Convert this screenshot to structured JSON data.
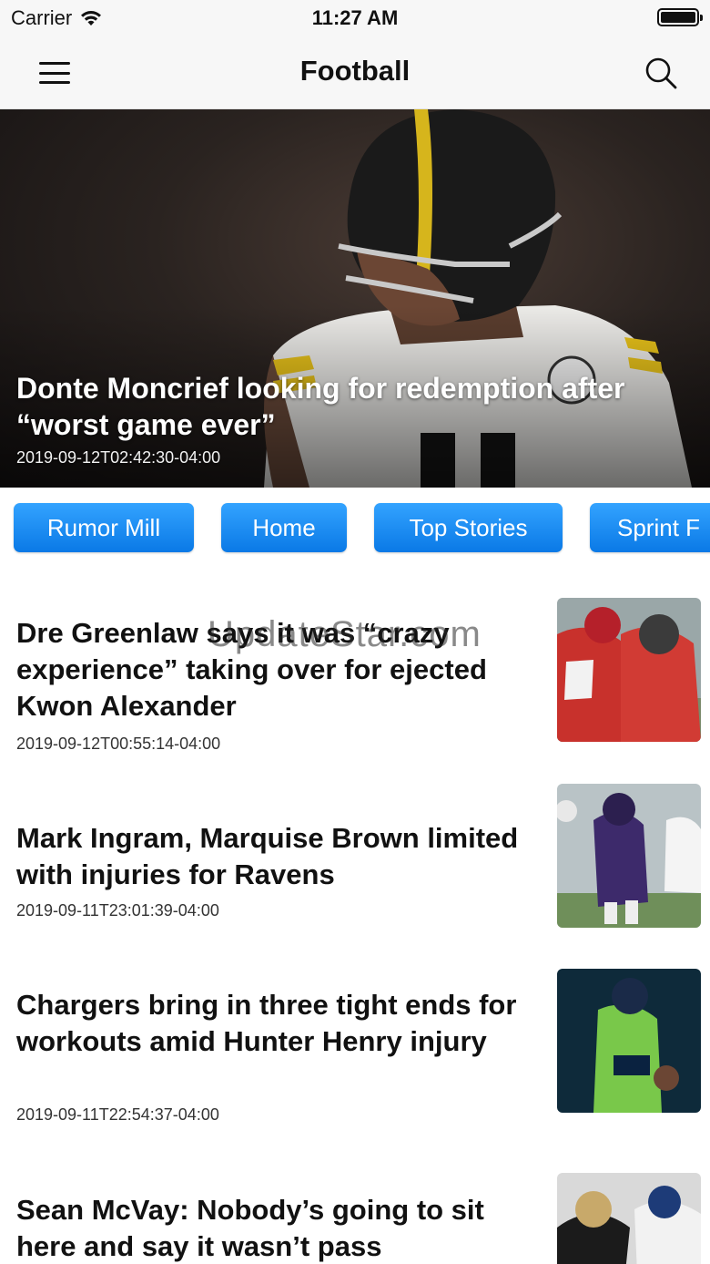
{
  "status_bar": {
    "carrier": "Carrier",
    "time": "11:27 AM"
  },
  "nav": {
    "title": "Football",
    "menu_icon": "hamburger-menu-icon",
    "search_icon": "search-icon"
  },
  "hero": {
    "title": "Donte Moncrief looking for redemption after “worst game ever”",
    "date": "2019-09-12T02:42:30-04:00"
  },
  "categories": [
    "Rumor Mill",
    "Home",
    "Top Stories",
    "Sprint F"
  ],
  "articles": [
    {
      "title": "Dre Greenlaw says it was “crazy experience” taking over for ejected Kwon Alexander",
      "date": "2019-09-12T00:55:14-04:00"
    },
    {
      "title": "Mark Ingram, Marquise Brown limited with injuries for Ravens",
      "date": "2019-09-11T23:01:39-04:00"
    },
    {
      "title": "Chargers bring in three tight ends for workouts amid Hunter Henry injury",
      "date": "2019-09-11T22:54:37-04:00"
    },
    {
      "title": "Sean McVay: Nobody’s going to sit here and say it wasn’t pass",
      "date": ""
    }
  ],
  "watermark": "UpdateStar.com",
  "colors": {
    "chip_top": "#33a3ff",
    "chip_bottom": "#0a79e6",
    "nav_background": "#f7f7f7"
  }
}
